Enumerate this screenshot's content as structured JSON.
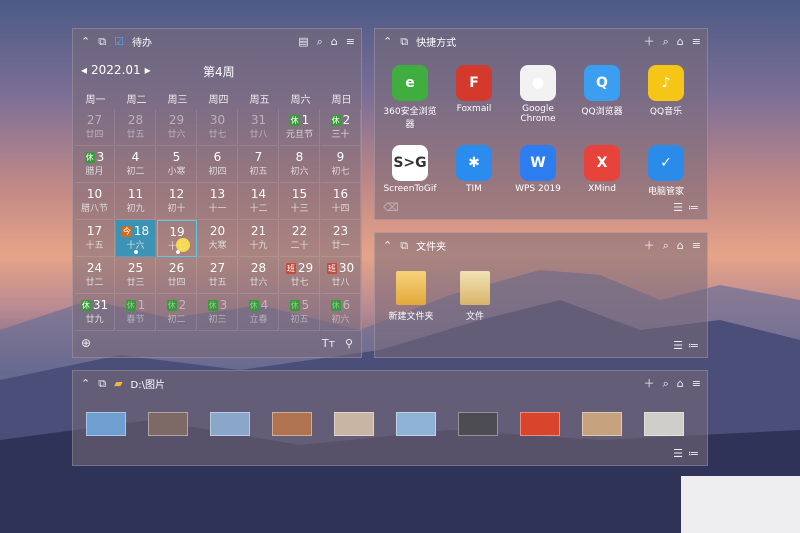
{
  "calendar_panel": {
    "title": "待办",
    "month": "2022.01",
    "week_label": "第4周",
    "weekdays": [
      "周一",
      "周二",
      "周三",
      "周四",
      "周五",
      "周六",
      "周日"
    ],
    "rows": [
      [
        {
          "n": "27",
          "s": "廿四",
          "dim": true
        },
        {
          "n": "28",
          "s": "廿五",
          "dim": true
        },
        {
          "n": "29",
          "s": "廿六",
          "dim": true
        },
        {
          "n": "30",
          "s": "廿七",
          "dim": true
        },
        {
          "n": "31",
          "s": "廿八",
          "dim": true
        },
        {
          "n": "1",
          "s": "元旦节",
          "tag": "休"
        },
        {
          "n": "2",
          "s": "三十",
          "tag": "休"
        }
      ],
      [
        {
          "n": "3",
          "s": "腊月",
          "tag": "休"
        },
        {
          "n": "4",
          "s": "初二"
        },
        {
          "n": "5",
          "s": "小寒"
        },
        {
          "n": "6",
          "s": "初四"
        },
        {
          "n": "7",
          "s": "初五"
        },
        {
          "n": "8",
          "s": "初六"
        },
        {
          "n": "9",
          "s": "初七"
        }
      ],
      [
        {
          "n": "10",
          "s": "腊八节"
        },
        {
          "n": "11",
          "s": "初九"
        },
        {
          "n": "12",
          "s": "初十"
        },
        {
          "n": "13",
          "s": "十一"
        },
        {
          "n": "14",
          "s": "十二"
        },
        {
          "n": "15",
          "s": "十三"
        },
        {
          "n": "16",
          "s": "十四"
        }
      ],
      [
        {
          "n": "17",
          "s": "十五"
        },
        {
          "n": "18",
          "s": "十六",
          "tag": "今",
          "sel": true
        },
        {
          "n": "19",
          "s": "十七",
          "cur": true
        },
        {
          "n": "20",
          "s": "大寒"
        },
        {
          "n": "21",
          "s": "十九"
        },
        {
          "n": "22",
          "s": "二十"
        },
        {
          "n": "23",
          "s": "廿一"
        }
      ],
      [
        {
          "n": "24",
          "s": "廿二"
        },
        {
          "n": "25",
          "s": "廿三"
        },
        {
          "n": "26",
          "s": "廿四"
        },
        {
          "n": "27",
          "s": "廿五"
        },
        {
          "n": "28",
          "s": "廿六"
        },
        {
          "n": "29",
          "s": "廿七",
          "tag": "班"
        },
        {
          "n": "30",
          "s": "廿八",
          "tag": "班"
        }
      ],
      [
        {
          "n": "31",
          "s": "廿九",
          "tag": "休"
        },
        {
          "n": "1",
          "s": "春节",
          "tag": "休",
          "dim": true
        },
        {
          "n": "2",
          "s": "初二",
          "tag": "休",
          "dim": true
        },
        {
          "n": "3",
          "s": "初三",
          "tag": "休",
          "dim": true
        },
        {
          "n": "4",
          "s": "立春",
          "tag": "休",
          "dim": true
        },
        {
          "n": "5",
          "s": "初五",
          "tag": "休",
          "dim": true
        },
        {
          "n": "6",
          "s": "初六",
          "tag": "休",
          "dim": true
        }
      ]
    ]
  },
  "shortcuts_panel": {
    "title": "快捷方式",
    "apps": [
      {
        "label": "360安全浏览器",
        "color": "#3fae3f",
        "glyph": "e"
      },
      {
        "label": "Foxmail",
        "color": "#d33a2c",
        "glyph": "F"
      },
      {
        "label": "Google Chrome",
        "color": "#f2f2f2",
        "glyph": "●"
      },
      {
        "label": "QQ浏览器",
        "color": "#3b9ef0",
        "glyph": "Q"
      },
      {
        "label": "QQ音乐",
        "color": "#f5c518",
        "glyph": "♪"
      },
      {
        "label": "ScreenToGif",
        "color": "#ffffff",
        "glyph": "S>G"
      },
      {
        "label": "TIM",
        "color": "#2a8cef",
        "glyph": "✱"
      },
      {
        "label": "WPS 2019",
        "color": "#2e7df0",
        "glyph": "W"
      },
      {
        "label": "XMind",
        "color": "#e8433b",
        "glyph": "X"
      },
      {
        "label": "电脑管家",
        "color": "#2b8be8",
        "glyph": "✓"
      }
    ]
  },
  "folder_panel": {
    "title": "文件夹",
    "items": [
      {
        "label": "新建文件夹"
      },
      {
        "label": "文件"
      }
    ]
  },
  "pictures_panel": {
    "title": "D:\\图片",
    "thumb_colors": [
      "#6f9ed0",
      "#7d6a66",
      "#8aa6c8",
      "#b07550",
      "#c9b5a3",
      "#8fb3d6",
      "#4c4c52",
      "#d8442c",
      "#c7a27e",
      "#d0cec8"
    ]
  }
}
